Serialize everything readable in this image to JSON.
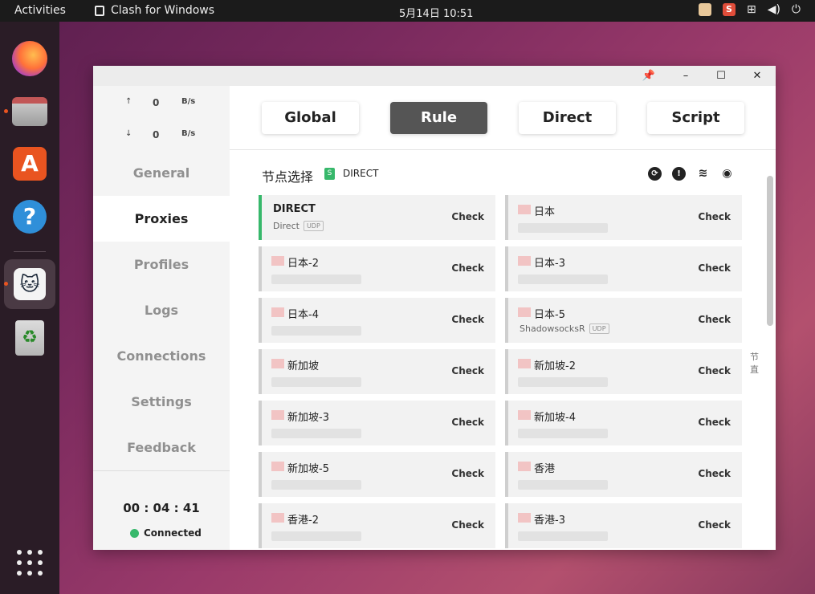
{
  "topbar": {
    "activities": "Activities",
    "app_name": "Clash for Windows",
    "clock": "5月14日  10:51"
  },
  "speed": {
    "up_value": "0",
    "up_unit": "B/s",
    "down_value": "0",
    "down_unit": "B/s"
  },
  "nav": [
    {
      "label": "General"
    },
    {
      "label": "Proxies"
    },
    {
      "label": "Profiles"
    },
    {
      "label": "Logs"
    },
    {
      "label": "Connections"
    },
    {
      "label": "Settings"
    },
    {
      "label": "Feedback"
    }
  ],
  "timer": "00 : 04 : 41",
  "status": "Connected",
  "modes": [
    {
      "label": "Global"
    },
    {
      "label": "Rule"
    },
    {
      "label": "Direct"
    },
    {
      "label": "Script"
    }
  ],
  "group": {
    "title": "节点选择",
    "badge": "S",
    "selected": "DIRECT"
  },
  "proxies": [
    {
      "name": "DIRECT",
      "type": "Direct",
      "udp": "UDP",
      "check": "Check"
    },
    {
      "name": "日本",
      "type": "",
      "udp": "",
      "check": "Check"
    },
    {
      "name": "日本-2",
      "type": "",
      "udp": "",
      "check": "Check"
    },
    {
      "name": "日本-3",
      "type": "",
      "udp": "",
      "check": "Check"
    },
    {
      "name": "日本-4",
      "type": "",
      "udp": "",
      "check": "Check"
    },
    {
      "name": "日本-5",
      "type": "ShadowsocksR",
      "udp": "UDP",
      "check": "Check"
    },
    {
      "name": "新加坡",
      "type": "",
      "udp": "",
      "check": "Check"
    },
    {
      "name": "新加坡-2",
      "type": "",
      "udp": "",
      "check": "Check"
    },
    {
      "name": "新加坡-3",
      "type": "",
      "udp": "",
      "check": "Check"
    },
    {
      "name": "新加坡-4",
      "type": "",
      "udp": "",
      "check": "Check"
    },
    {
      "name": "新加坡-5",
      "type": "",
      "udp": "",
      "check": "Check"
    },
    {
      "name": "香港",
      "type": "",
      "udp": "",
      "check": "Check"
    },
    {
      "name": "香港-2",
      "type": "",
      "udp": "",
      "check": "Check"
    },
    {
      "name": "香港-3",
      "type": "",
      "udp": "",
      "check": "Check"
    }
  ],
  "side_mark": "节直",
  "colors": {
    "accent_green": "#37b86b",
    "active_mode": "#555555"
  }
}
